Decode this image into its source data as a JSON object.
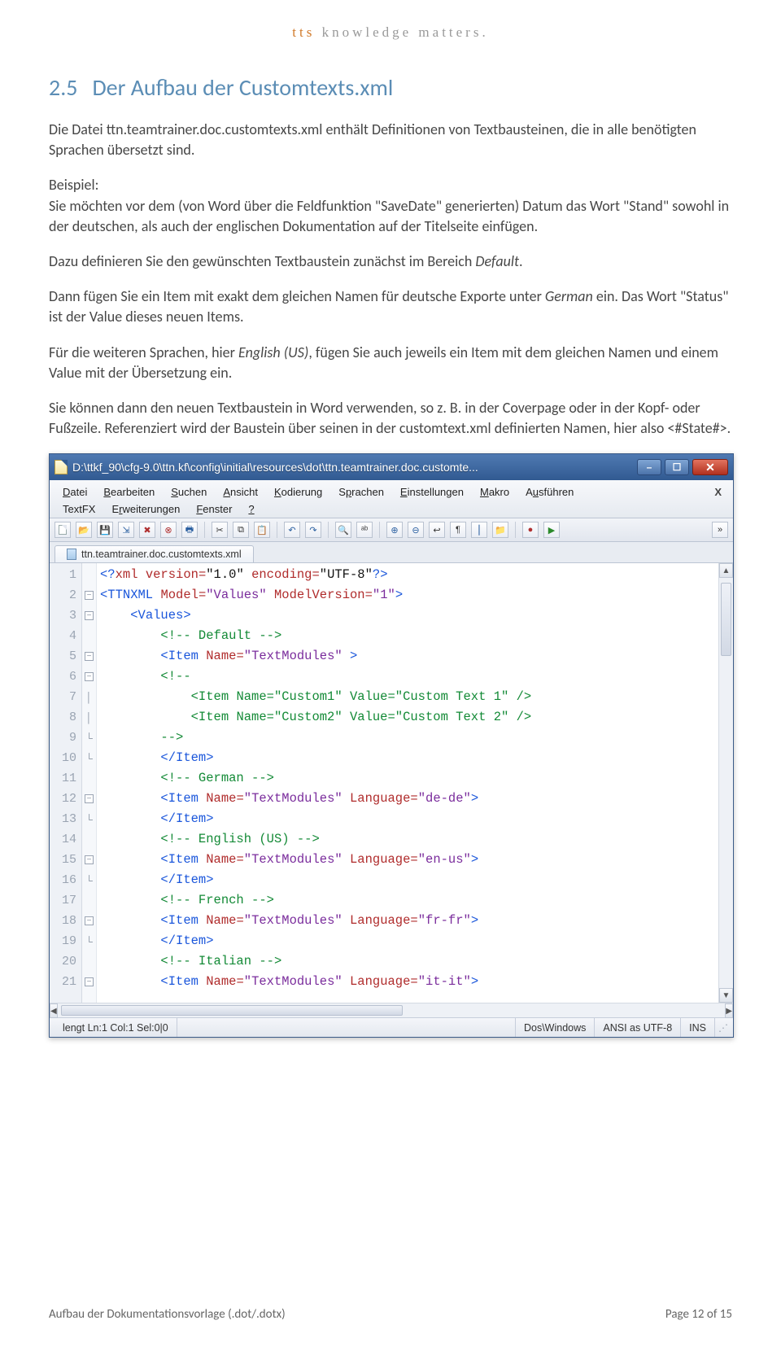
{
  "brand": {
    "tts": "tts",
    "tag": "knowledge matters."
  },
  "section": {
    "num": "2.5",
    "title": "Der Aufbau der Customtexts.xml"
  },
  "paras": {
    "p1": "Die Datei ttn.teamtrainer.doc.customtexts.xml enthält Definitionen von Textbausteinen, die in alle benötigten Sprachen übersetzt sind.",
    "p2a": "Beispiel:",
    "p2b": "Sie möchten vor dem (von Word über die Feldfunktion \"SaveDate\" generierten) Datum das Wort \"Stand\" sowohl in der deutschen, als auch der englischen Dokumentation auf der Titelseite einfügen.",
    "p3a": "Dazu definieren Sie den gewünschten Textbaustein zunächst im Bereich ",
    "p3b": "Default",
    "p3c": ".",
    "p4a": "Dann fügen Sie ein Item mit exakt dem gleichen Namen für deutsche Exporte unter ",
    "p4b": "German",
    "p4c": " ein. Das Wort \"Status\" ist der Value dieses neuen Items.",
    "p5a": "Für die weiteren Sprachen, hier ",
    "p5b": "English (US)",
    "p5c": ", fügen Sie auch jeweils ein Item mit dem gleichen Namen und einem Value mit der Übersetzung ein.",
    "p6": "Sie können dann den neuen Textbaustein in Word verwenden, so z. B. in der Coverpage oder in der Kopf- oder Fußzeile. Referenziert wird der Baustein über seinen in der customtext.xml definierten Namen, hier also <#State#>."
  },
  "window": {
    "title": "D:\\ttkf_90\\cfg-9.0\\ttn.kf\\config\\initial\\resources\\dot\\ttn.teamtrainer.doc.customte...",
    "menus": [
      "Datei",
      "Bearbeiten",
      "Suchen",
      "Ansicht",
      "Kodierung",
      "Sprachen",
      "Einstellungen",
      "Makro",
      "Ausführen",
      "TextFX",
      "Erweiterungen",
      "Fenster",
      "?"
    ],
    "menu_close": "X",
    "tab": "ttn.teamtrainer.doc.customtexts.xml",
    "status": {
      "left": "lengt Ln:1   Col:1   Sel:0|0",
      "eol": "Dos\\Windows",
      "enc": "ANSI as UTF-8",
      "ins": "INS"
    },
    "code": {
      "lines": [
        {
          "n": 1,
          "fold": "",
          "raw": "decl"
        },
        {
          "n": 2,
          "fold": "box-",
          "indent": 0,
          "tag_open": "TTNXML",
          "attrs": [
            [
              "Model",
              "Values"
            ],
            [
              "ModelVersion",
              "1"
            ]
          ]
        },
        {
          "n": 3,
          "fold": "box-",
          "indent": 1,
          "tag_open": "Values"
        },
        {
          "n": 4,
          "fold": "",
          "indent": 2,
          "comment": " Default "
        },
        {
          "n": 5,
          "fold": "box-",
          "indent": 2,
          "tag_open": "Item",
          "attrs": [
            [
              "Name",
              "TextModules"
            ]
          ],
          "gt": " >"
        },
        {
          "n": 6,
          "fold": "box-",
          "indent": 2,
          "comment_open": true
        },
        {
          "n": 7,
          "fold": "|",
          "indent": 3,
          "self": "Item",
          "attrs": [
            [
              "Name",
              "Custom1"
            ],
            [
              "Value",
              "Custom Text 1"
            ]
          ]
        },
        {
          "n": 8,
          "fold": "|",
          "indent": 3,
          "self": "Item",
          "attrs": [
            [
              "Name",
              "Custom2"
            ],
            [
              "Value",
              "Custom Text 2"
            ]
          ]
        },
        {
          "n": 9,
          "fold": "-",
          "indent": 2,
          "comment_close": true
        },
        {
          "n": 10,
          "fold": "-",
          "indent": 2,
          "tag_close": "Item"
        },
        {
          "n": 11,
          "fold": "",
          "indent": 2,
          "comment": " German "
        },
        {
          "n": 12,
          "fold": "box-",
          "indent": 2,
          "tag_open": "Item",
          "attrs": [
            [
              "Name",
              "TextModules"
            ],
            [
              "Language",
              "de-de"
            ]
          ]
        },
        {
          "n": 13,
          "fold": "-",
          "indent": 2,
          "tag_close": "Item"
        },
        {
          "n": 14,
          "fold": "",
          "indent": 2,
          "comment": " English (US) "
        },
        {
          "n": 15,
          "fold": "box-",
          "indent": 2,
          "tag_open": "Item",
          "attrs": [
            [
              "Name",
              "TextModules"
            ],
            [
              "Language",
              "en-us"
            ]
          ]
        },
        {
          "n": 16,
          "fold": "-",
          "indent": 2,
          "tag_close": "Item"
        },
        {
          "n": 17,
          "fold": "",
          "indent": 2,
          "comment": " French "
        },
        {
          "n": 18,
          "fold": "box-",
          "indent": 2,
          "tag_open": "Item",
          "attrs": [
            [
              "Name",
              "TextModules"
            ],
            [
              "Language",
              "fr-fr"
            ]
          ]
        },
        {
          "n": 19,
          "fold": "-",
          "indent": 2,
          "tag_close": "Item"
        },
        {
          "n": 20,
          "fold": "",
          "indent": 2,
          "comment": " Italian "
        },
        {
          "n": 21,
          "fold": "box-",
          "indent": 2,
          "tag_open": "Item",
          "attrs": [
            [
              "Name",
              "TextModules"
            ],
            [
              "Language",
              "it-it"
            ]
          ]
        }
      ]
    }
  },
  "footer": {
    "left": "Aufbau der Dokumentationsvorlage (.dot/.dotx)",
    "right": "Page 12 of 15"
  }
}
